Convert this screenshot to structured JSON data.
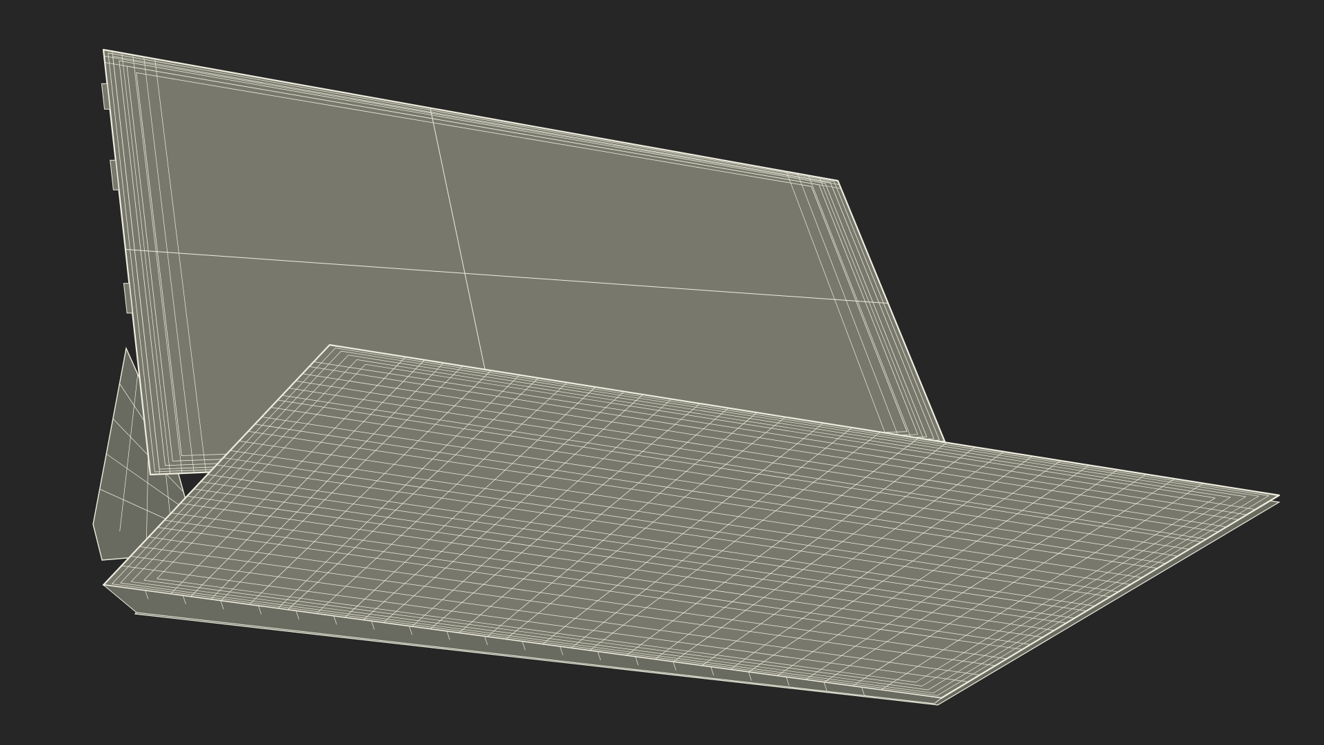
{
  "scene": {
    "subject": "tablet-with-keyboard-cover-wireframe",
    "colors": {
      "background": "#262626",
      "surface": "#78796c",
      "surface_shadow": "#6a6b60",
      "wire": "#efeee0"
    }
  }
}
